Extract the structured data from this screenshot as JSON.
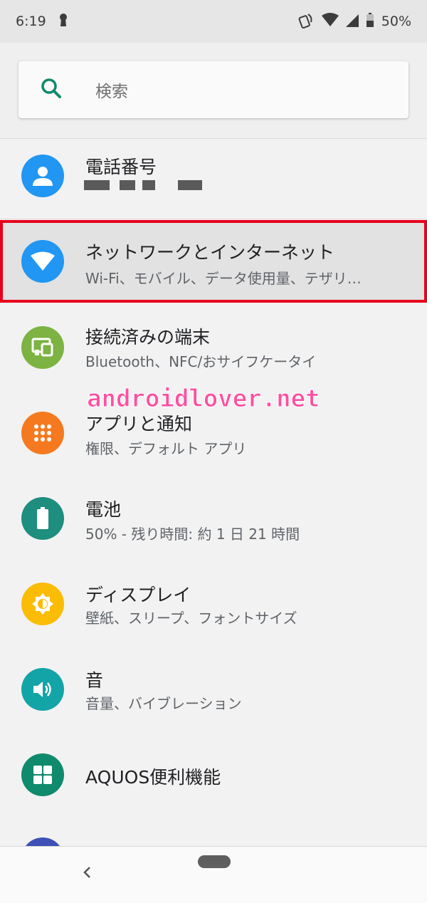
{
  "status_bar": {
    "time": "6:19",
    "battery": "50%"
  },
  "search": {
    "placeholder": "検索"
  },
  "account": {
    "title": "電話番号"
  },
  "items": [
    {
      "title": "ネットワークとインターネット",
      "subtitle": "Wi-Fi、モバイル、データ使用量、テザリ…",
      "icon": "wifi-icon",
      "color": "#2196f3"
    },
    {
      "title": "接続済みの端末",
      "subtitle": "Bluetooth、NFC/おサイフケータイ",
      "icon": "devices-icon",
      "color": "#7cb342"
    },
    {
      "title": "アプリと通知",
      "subtitle": "権限、デフォルト アプリ",
      "icon": "apps-icon",
      "color": "#f4791f"
    },
    {
      "title": "電池",
      "subtitle": "50% - 残り時間: 約 1 日 21 時間",
      "icon": "battery-icon",
      "color": "#1e8e7e"
    },
    {
      "title": "ディスプレイ",
      "subtitle": "壁紙、スリープ、フォントサイズ",
      "icon": "brightness-icon",
      "color": "#fbbc05"
    },
    {
      "title": "音",
      "subtitle": "音量、バイブレーション",
      "icon": "volume-icon",
      "color": "#12a4a7"
    },
    {
      "title": "AQUOS便利機能",
      "subtitle": "",
      "icon": "grid-icon",
      "color": "#0f8a6c"
    }
  ],
  "watermark": "androidlover.net"
}
